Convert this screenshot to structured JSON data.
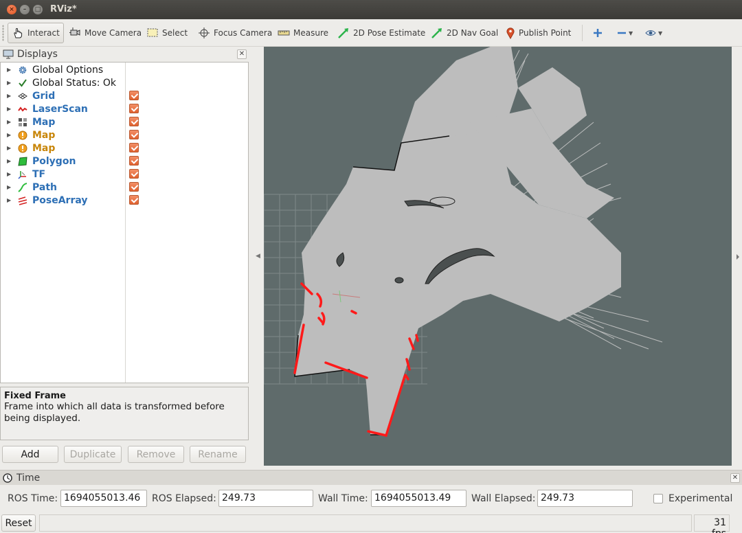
{
  "window": {
    "title": "RViz*"
  },
  "toolbar": {
    "interact": "Interact",
    "move_camera": "Move Camera",
    "select": "Select",
    "focus_camera": "Focus Camera",
    "measure": "Measure",
    "pose_estimate": "2D Pose Estimate",
    "nav_goal": "2D Nav Goal",
    "publish_point": "Publish Point"
  },
  "displays": {
    "title": "Displays",
    "items": [
      {
        "label": "Global Options",
        "style": "plain",
        "icon": "gear-icon",
        "checked": null
      },
      {
        "label": "Global Status: Ok",
        "style": "plain",
        "icon": "checkmark-icon",
        "checked": null
      },
      {
        "label": "Grid",
        "style": "blue",
        "icon": "grid-icon",
        "checked": true
      },
      {
        "label": "LaserScan",
        "style": "blue",
        "icon": "laserscan-icon",
        "checked": true
      },
      {
        "label": "Map",
        "style": "blue",
        "icon": "map-icon",
        "checked": true
      },
      {
        "label": "Map",
        "style": "warn",
        "icon": "warning-icon",
        "checked": true
      },
      {
        "label": "Map",
        "style": "warn",
        "icon": "warning-icon",
        "checked": true
      },
      {
        "label": "Polygon",
        "style": "blue",
        "icon": "polygon-icon",
        "checked": true
      },
      {
        "label": "TF",
        "style": "blue",
        "icon": "tf-icon",
        "checked": true
      },
      {
        "label": "Path",
        "style": "blue",
        "icon": "path-icon",
        "checked": true
      },
      {
        "label": "PoseArray",
        "style": "blue",
        "icon": "posearray-icon",
        "checked": true
      }
    ],
    "description_title": "Fixed Frame",
    "description_text": "Frame into which all data is transformed before being displayed.",
    "buttons": {
      "add": "Add",
      "duplicate": "Duplicate",
      "remove": "Remove",
      "rename": "Rename"
    }
  },
  "time": {
    "title": "Time",
    "ros_time_label": "ROS Time:",
    "ros_time_value": "1694055013.46",
    "ros_elapsed_label": "ROS Elapsed:",
    "ros_elapsed_value": "249.73",
    "wall_time_label": "Wall Time:",
    "wall_time_value": "1694055013.49",
    "wall_elapsed_label": "Wall Elapsed:",
    "wall_elapsed_value": "249.73",
    "experimental_label": "Experimental"
  },
  "statusbar": {
    "reset": "Reset",
    "fps": "31 fps"
  },
  "colors": {
    "viewport_bg": "#5f6b6b",
    "map_free": "#bdbdbd",
    "laser": "#ff0000",
    "accent_blue": "#2d6fb5",
    "warn": "#c8860a",
    "checkbox": "#e8703f"
  }
}
